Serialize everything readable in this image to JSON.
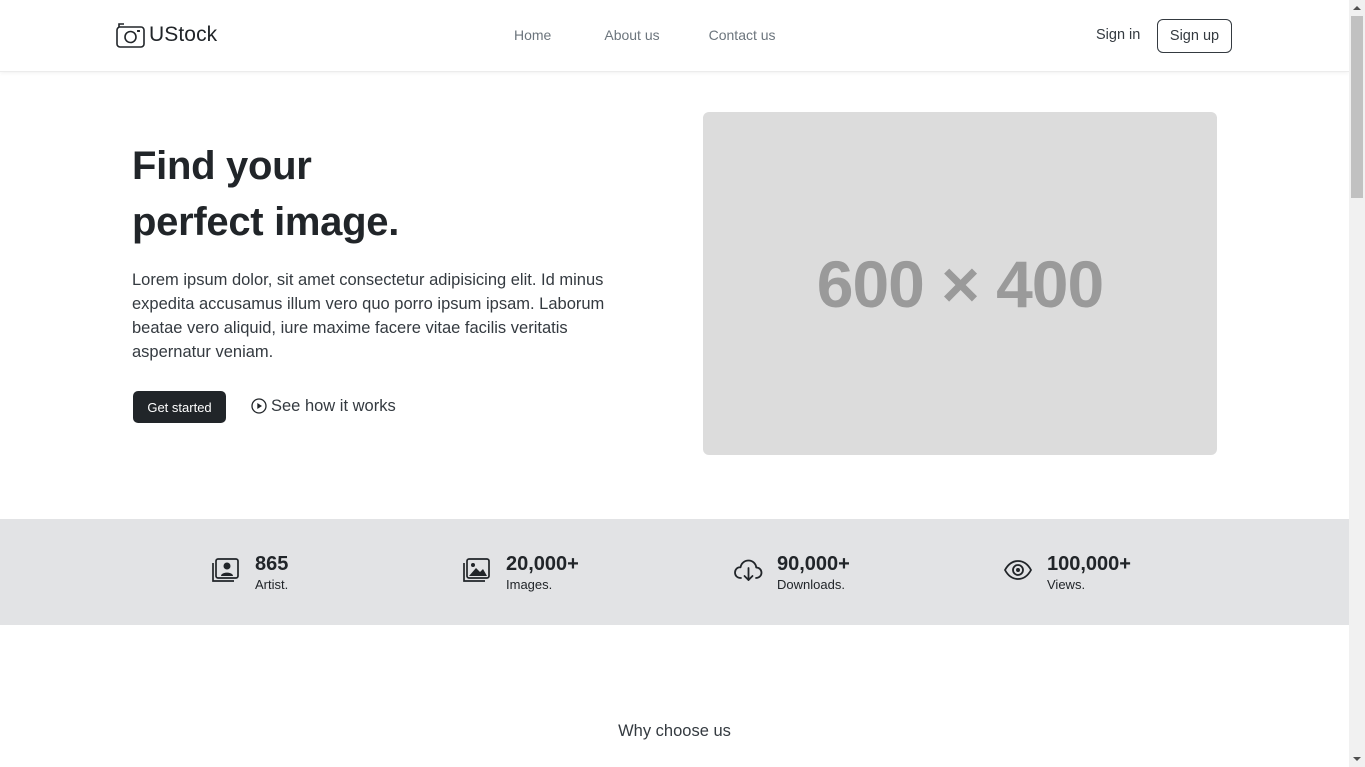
{
  "brand": {
    "name": "UStock",
    "logo_icon": "camera-icon"
  },
  "nav": {
    "links": [
      {
        "label": "Home"
      },
      {
        "label": "About us"
      },
      {
        "label": "Contact us"
      }
    ],
    "signin_label": "Sign in",
    "signup_label": "Sign up"
  },
  "hero": {
    "title_line1": "Find your",
    "title_line2": "perfect image.",
    "text": "Lorem ipsum dolor, sit amet consectetur adipisicing elit. Id minus expedita accusamus illum vero quo porro ipsum ipsam. Laborum beatae vero aliquid, iure maxime facere vitae facilis veritatis aspernatur veniam.",
    "primary_button": "Get started",
    "secondary_link": "See how it works",
    "placeholder_text": "600 × 400"
  },
  "stats": [
    {
      "value": "865",
      "label": "Artist.",
      "icon": "person-portrait-icon"
    },
    {
      "value": "20,000+",
      "label": "Images.",
      "icon": "images-icon"
    },
    {
      "value": "90,000+",
      "label": "Downloads.",
      "icon": "cloud-download-icon"
    },
    {
      "value": "100,000+",
      "label": "Views.",
      "icon": "eye-icon"
    }
  ],
  "why_title": "Why choose us",
  "colors": {
    "dark": "#212529",
    "stats_bg": "#e2e3e5",
    "placeholder_bg": "#dcdcdc",
    "placeholder_text": "#9a9a9a"
  }
}
